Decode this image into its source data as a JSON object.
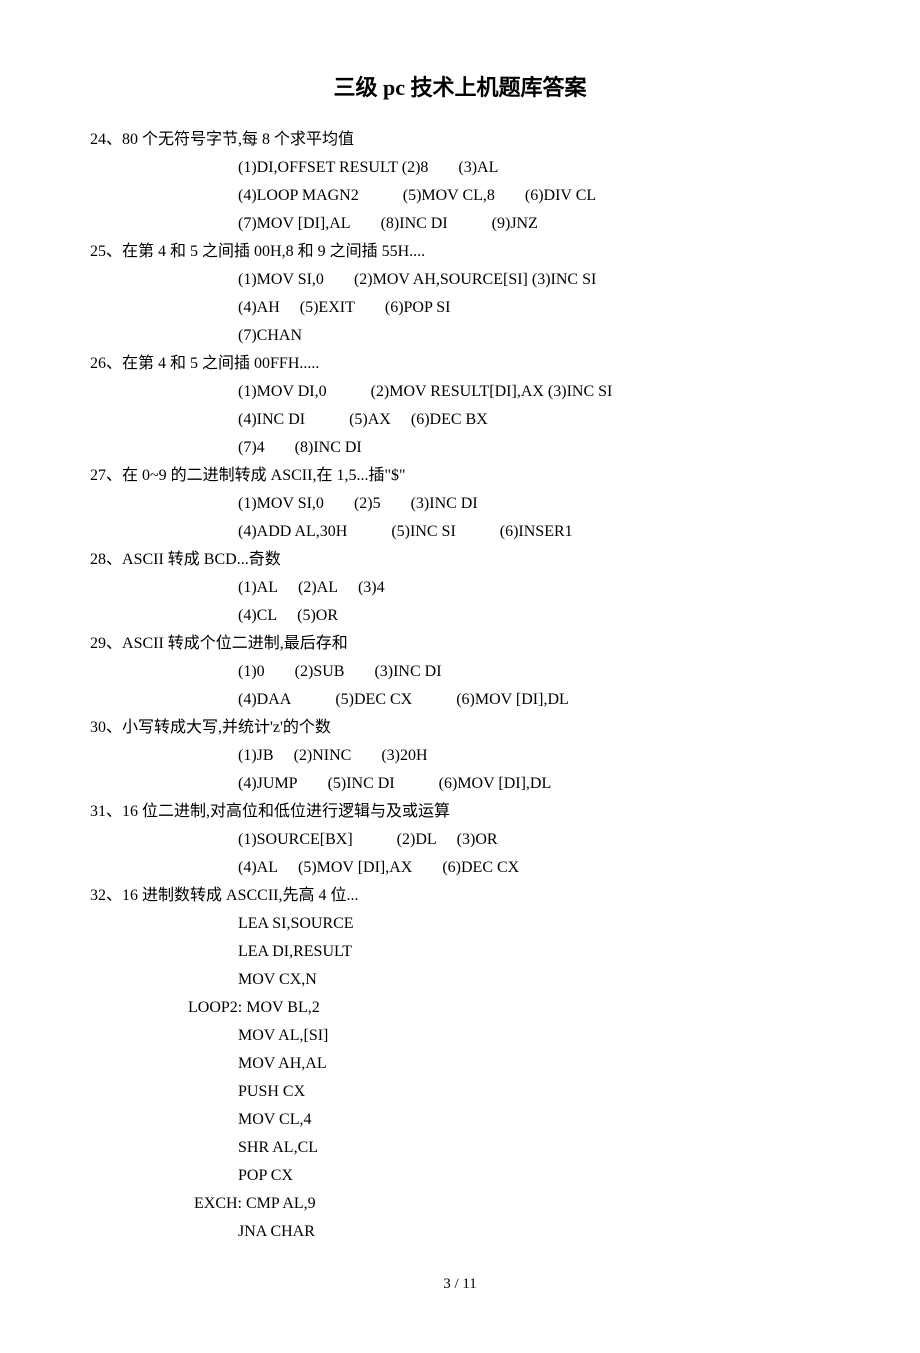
{
  "title": "三级 pc 技术上机题库答案",
  "page_number": "3  /  11",
  "questions": [
    {
      "num": "24、",
      "desc": "80 个无符号字节,每 8 个求平均值",
      "answers": [
        [
          "(1)DI,OFFSET RESULT",
          "(2)8",
          "(3)AL"
        ],
        [
          "(4)LOOP MAGN2",
          "(5)MOV CL,8",
          "(6)DIV CL"
        ],
        [
          "(7)MOV [DI],AL",
          "(8)INC DI",
          "(9)JNZ"
        ]
      ]
    },
    {
      "num": "25、",
      "desc": "在第 4 和 5 之间插 00H,8 和 9 之间插 55H....",
      "answers": [
        [
          "(1)MOV SI,0",
          "(2)MOV AH,SOURCE[SI]",
          "(3)INC SI"
        ],
        [
          "(4)AH",
          "(5)EXIT",
          "(6)POP SI"
        ],
        [
          "(7)CHAN"
        ]
      ]
    },
    {
      "num": "26、",
      "desc": "在第 4 和 5 之间插 00FFH.....",
      "answers": [
        [
          "(1)MOV DI,0",
          "(2)MOV RESULT[DI],AX",
          "(3)INC SI"
        ],
        [
          "(4)INC DI",
          "(5)AX",
          "(6)DEC BX"
        ],
        [
          "(7)4",
          "(8)INC DI"
        ]
      ]
    },
    {
      "num": "27、",
      "desc": "在 0~9 的二进制转成 ASCII,在 1,5...插\"$\"",
      "answers": [
        [
          "(1)MOV SI,0",
          "(2)5",
          "(3)INC DI"
        ],
        [
          "(4)ADD AL,30H",
          "(5)INC SI",
          "(6)INSER1"
        ]
      ]
    },
    {
      "num": "28、",
      "desc": "ASCII 转成 BCD...奇数",
      "answers": [
        [
          "(1)AL",
          "(2)AL",
          "(3)4"
        ],
        [
          "(4)CL",
          "(5)OR"
        ]
      ]
    },
    {
      "num": "29、",
      "desc": "ASCII 转成个位二进制,最后存和",
      "answers": [
        [
          "(1)0",
          "(2)SUB",
          "(3)INC DI"
        ],
        [
          "(4)DAA",
          "(5)DEC CX",
          "(6)MOV [DI],DL"
        ]
      ]
    },
    {
      "num": "30、",
      "desc": "小写转成大写,并统计'z'的个数",
      "answers": [
        [
          "(1)JB",
          "(2)NINC",
          "(3)20H"
        ],
        [
          "(4)JUMP",
          "(5)INC DI",
          "(6)MOV [DI],DL"
        ]
      ]
    },
    {
      "num": "31、",
      "desc": "16 位二进制,对高位和低位进行逻辑与及或运算",
      "answers": [
        [
          "(1)SOURCE[BX]",
          "(2)DL",
          "(3)OR"
        ],
        [
          "(4)AL",
          "(5)MOV [DI],AX",
          "(6)DEC CX"
        ]
      ]
    },
    {
      "num": "32、",
      "desc": "16 进制数转成 ASCCII,先高 4 位...",
      "code": [
        {
          "label": "",
          "text": "LEA SI,SOURCE"
        },
        {
          "label": "",
          "text": "LEA DI,RESULT"
        },
        {
          "label": "",
          "text": "MOV CX,N"
        },
        {
          "label": "LOOP2:",
          "text": "MOV BL,2"
        },
        {
          "label": "",
          "text": "MOV AL,[SI]"
        },
        {
          "label": "",
          "text": "MOV AH,AL"
        },
        {
          "label": "",
          "text": "PUSH CX"
        },
        {
          "label": "",
          "text": "MOV CL,4"
        },
        {
          "label": "",
          "text": "SHR AL,CL"
        },
        {
          "label": "",
          "text": "POP CX"
        },
        {
          "label": "EXCH:",
          "text": "CMP AL,9"
        },
        {
          "label": "",
          "text": "JNA CHAR"
        }
      ]
    }
  ]
}
